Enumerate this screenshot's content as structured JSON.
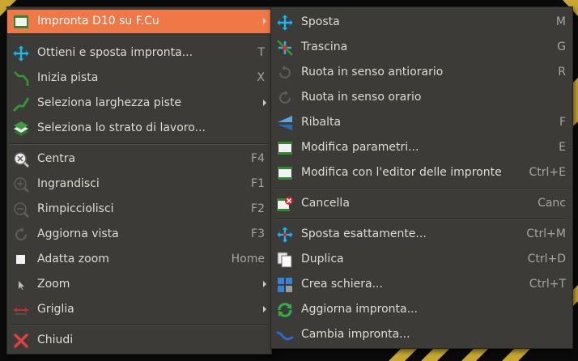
{
  "main_menu": {
    "items": [
      {
        "label": "Impronta D10 su F.Cu",
        "shortcut": "",
        "icon": "footprint-icon"
      },
      {
        "label": "Ottieni e sposta impronta...",
        "shortcut": "T",
        "icon": "move-cross-icon"
      },
      {
        "label": "Inizia pista",
        "shortcut": "X",
        "icon": "track-icon"
      },
      {
        "label": "Seleziona larghezza piste",
        "shortcut": "",
        "icon": "track-width-icon"
      },
      {
        "label": "Seleziona lo strato di lavoro...",
        "shortcut": "",
        "icon": "layers-icon"
      },
      {
        "label": "Centra",
        "shortcut": "F4",
        "icon": "zoom-center-icon"
      },
      {
        "label": "Ingrandisci",
        "shortcut": "F1",
        "icon": "zoom-in-icon"
      },
      {
        "label": "Rimpicciolisci",
        "shortcut": "F2",
        "icon": "zoom-out-icon"
      },
      {
        "label": "Aggiorna vista",
        "shortcut": "F3",
        "icon": "refresh-view-icon"
      },
      {
        "label": "Adatta zoom",
        "shortcut": "Home",
        "icon": "zoom-fit-icon"
      },
      {
        "label": "Zoom",
        "shortcut": "",
        "icon": "zoom-cursor-icon"
      },
      {
        "label": "Griglia",
        "shortcut": "",
        "icon": "grid-icon"
      },
      {
        "label": "Chiudi",
        "shortcut": "",
        "icon": "close-icon"
      }
    ]
  },
  "sub_menu": {
    "items": [
      {
        "label": "Sposta",
        "shortcut": "M",
        "icon": "move-cross-icon"
      },
      {
        "label": "Trascina",
        "shortcut": "G",
        "icon": "drag-icon"
      },
      {
        "label": "Ruota in senso antiorario",
        "shortcut": "R",
        "icon": "rotate-ccw-icon"
      },
      {
        "label": "Ruota in senso orario",
        "shortcut": "",
        "icon": "rotate-cw-icon"
      },
      {
        "label": "Ribalta",
        "shortcut": "F",
        "icon": "flip-icon"
      },
      {
        "label": "Modifica parametri...",
        "shortcut": "E",
        "icon": "footprint-params-icon"
      },
      {
        "label": "Modifica con l'editor delle impronte",
        "shortcut": "Ctrl+E",
        "icon": "footprint-editor-icon"
      },
      {
        "label": "Cancella",
        "shortcut": "Canc",
        "icon": "delete-icon"
      },
      {
        "label": "Sposta esattamente...",
        "shortcut": "Ctrl+M",
        "icon": "move-exact-icon"
      },
      {
        "label": "Duplica",
        "shortcut": "Ctrl+D",
        "icon": "duplicate-icon"
      },
      {
        "label": "Crea schiera...",
        "shortcut": "Ctrl+T",
        "icon": "array-icon"
      },
      {
        "label": "Aggiorna impronta...",
        "shortcut": "",
        "icon": "update-footprint-icon"
      },
      {
        "label": "Cambia impronta...",
        "shortcut": "",
        "icon": "change-footprint-icon"
      }
    ]
  },
  "colors": {
    "highlight": "#f07746",
    "menu_bg": "#3c3b37",
    "text": "#dfdbd2",
    "shortcut": "#a7a59f"
  }
}
